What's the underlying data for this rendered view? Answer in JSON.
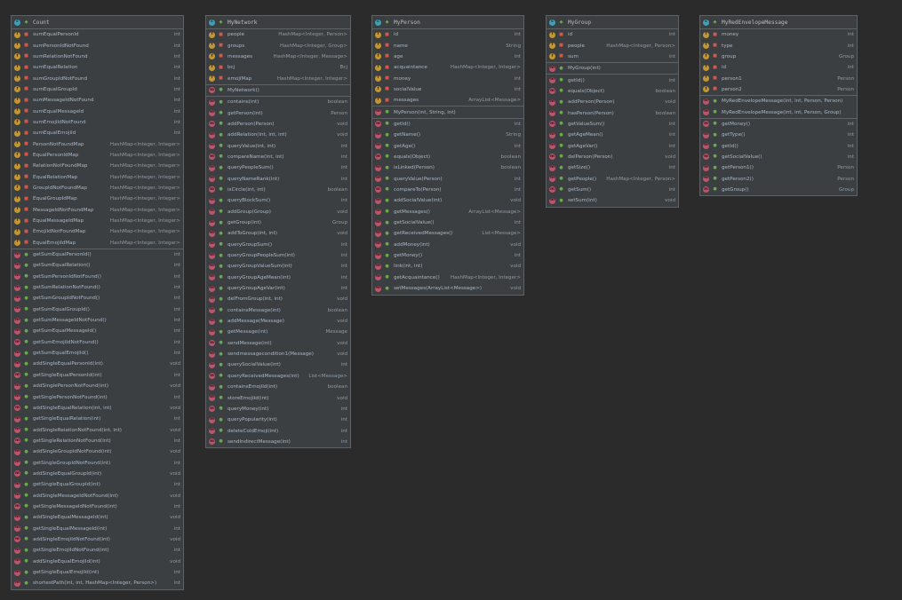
{
  "diagram": {
    "classes": [
      {
        "id": "count",
        "name": "Count",
        "fields": [
          {
            "name": "sumEqualPersonId",
            "type": "int"
          },
          {
            "name": "sumPersonIdNotFound",
            "type": "int"
          },
          {
            "name": "sumRelationNotFound",
            "type": "int"
          },
          {
            "name": "sumEqualRelation",
            "type": "int"
          },
          {
            "name": "sumGroupIdNotFound",
            "type": "int"
          },
          {
            "name": "sumEqualGroupId",
            "type": "int"
          },
          {
            "name": "sumMessageIdNotFound",
            "type": "int"
          },
          {
            "name": "sumEqualMessageId",
            "type": "int"
          },
          {
            "name": "sumEmojiIdNotFound",
            "type": "int"
          },
          {
            "name": "sumEqualEmojiId",
            "type": "int"
          },
          {
            "name": "PersonNotFoundMap",
            "type": "HashMap<Integer, Integer>"
          },
          {
            "name": "EqualPersonIdMap",
            "type": "HashMap<Integer, Integer>"
          },
          {
            "name": "RelationNotFoundMap",
            "type": "HashMap<Integer, Integer>"
          },
          {
            "name": "EqualRelationMap",
            "type": "HashMap<Integer, Integer>"
          },
          {
            "name": "GroupIdNotFoundMap",
            "type": "HashMap<Integer, Integer>"
          },
          {
            "name": "EqualGroupIdMap",
            "type": "HashMap<Integer, Integer>"
          },
          {
            "name": "MessageIdNotFoundMap",
            "type": "HashMap<Integer, Integer>"
          },
          {
            "name": "EqualMessageIdMap",
            "type": "HashMap<Integer, Integer>"
          },
          {
            "name": "EmojiIdNotFoundMap",
            "type": "HashMap<Integer, Integer>"
          },
          {
            "name": "EqualEmojiIdMap",
            "type": "HashMap<Integer, Integer>"
          }
        ],
        "constructors": [],
        "methods": [
          {
            "name": "getSumEqualPersonId()",
            "type": "int"
          },
          {
            "name": "getSumEqualRelation()",
            "type": "int"
          },
          {
            "name": "getSumPersonIdNotFound()",
            "type": "int"
          },
          {
            "name": "getSumRelationNotFound()",
            "type": "int"
          },
          {
            "name": "getSumGroupIdNotFound()",
            "type": "int"
          },
          {
            "name": "getSumEqualGroupId()",
            "type": "int"
          },
          {
            "name": "getSumMessageIdNotFound()",
            "type": "int"
          },
          {
            "name": "getSumEqualMessageId()",
            "type": "int"
          },
          {
            "name": "getSumEmojiIdNotFound()",
            "type": "int"
          },
          {
            "name": "getSumEqualEmojiId()",
            "type": "int"
          },
          {
            "name": "addSingleEqualPersonId(int)",
            "type": "void"
          },
          {
            "name": "getSingleEqualPersonId(int)",
            "type": "int"
          },
          {
            "name": "addSinglePersonNotFound(int)",
            "type": "void"
          },
          {
            "name": "getSinglePersonNotFound(int)",
            "type": "int"
          },
          {
            "name": "addSingleEqualRelation(int, int)",
            "type": "void"
          },
          {
            "name": "getSingleEqualRelation(int)",
            "type": "int"
          },
          {
            "name": "addSingleRelationNotFound(int, int)",
            "type": "void"
          },
          {
            "name": "getSingleRelationNotFound(int)",
            "type": "int"
          },
          {
            "name": "addSingleGroupIdNotFound(int)",
            "type": "void"
          },
          {
            "name": "getSingleGroupIdNotFound(int)",
            "type": "int"
          },
          {
            "name": "addSingleEqualGroupId(int)",
            "type": "void"
          },
          {
            "name": "getSingleEqualGroupId(int)",
            "type": "int"
          },
          {
            "name": "addSingleMessageIdNotFound(int)",
            "type": "void"
          },
          {
            "name": "getSingleMessageIdNotFound(int)",
            "type": "int"
          },
          {
            "name": "addSingleEqualMessageId(int)",
            "type": "void"
          },
          {
            "name": "getSingleEqualMessageId(int)",
            "type": "int"
          },
          {
            "name": "addSingleEmojiIdNotFound(int)",
            "type": "void"
          },
          {
            "name": "getSingleEmojiIdNotFound(int)",
            "type": "int"
          },
          {
            "name": "addSingleEqualEmojiId(int)",
            "type": "void"
          },
          {
            "name": "getSingleEqualEmojiId(int)",
            "type": "int"
          },
          {
            "name": "shortestPath(int, int, HashMap<Integer, Person>)",
            "type": "int"
          }
        ]
      },
      {
        "id": "mynetwork",
        "name": "MyNetwork",
        "fields": [
          {
            "name": "people",
            "type": "HashMap<Integer, Person>"
          },
          {
            "name": "groups",
            "type": "HashMap<Integer, Group>"
          },
          {
            "name": "messages",
            "type": "HashMap<Integer, Message>"
          },
          {
            "name": "bcj",
            "type": "Bcj"
          },
          {
            "name": "emojiMap",
            "type": "HashMap<Integer, Integer>"
          }
        ],
        "constructors": [
          {
            "name": "MyNetwork()",
            "type": ""
          }
        ],
        "methods": [
          {
            "name": "contains(int)",
            "type": "boolean"
          },
          {
            "name": "getPerson(int)",
            "type": "Person"
          },
          {
            "name": "addPerson(Person)",
            "type": "void"
          },
          {
            "name": "addRelation(int, int, int)",
            "type": "void"
          },
          {
            "name": "queryValue(int, int)",
            "type": "int"
          },
          {
            "name": "compareName(int, int)",
            "type": "int"
          },
          {
            "name": "queryPeopleSum()",
            "type": "int"
          },
          {
            "name": "queryNameRank(int)",
            "type": "int"
          },
          {
            "name": "isCircle(int, int)",
            "type": "boolean"
          },
          {
            "name": "queryBlockSum()",
            "type": "int"
          },
          {
            "name": "addGroup(Group)",
            "type": "void"
          },
          {
            "name": "getGroup(int)",
            "type": "Group"
          },
          {
            "name": "addToGroup(int, int)",
            "type": "void"
          },
          {
            "name": "queryGroupSum()",
            "type": "int"
          },
          {
            "name": "queryGroupPeopleSum(int)",
            "type": "int"
          },
          {
            "name": "queryGroupValueSum(int)",
            "type": "int"
          },
          {
            "name": "queryGroupAgeMean(int)",
            "type": "int"
          },
          {
            "name": "queryGroupAgeVar(int)",
            "type": "int"
          },
          {
            "name": "delFromGroup(int, int)",
            "type": "void"
          },
          {
            "name": "containsMessage(int)",
            "type": "boolean"
          },
          {
            "name": "addMessage(Message)",
            "type": "void"
          },
          {
            "name": "getMessage(int)",
            "type": "Message"
          },
          {
            "name": "sendMessage(int)",
            "type": "void"
          },
          {
            "name": "sendmessagecondition1(Message)",
            "type": "void"
          },
          {
            "name": "querySocialValue(int)",
            "type": "int"
          },
          {
            "name": "queryReceivedMessages(int)",
            "type": "List<Message>"
          },
          {
            "name": "containsEmojiId(int)",
            "type": "boolean"
          },
          {
            "name": "storeEmojiId(int)",
            "type": "void"
          },
          {
            "name": "queryMoney(int)",
            "type": "int"
          },
          {
            "name": "queryPopularity(int)",
            "type": "int"
          },
          {
            "name": "deleteColdEmoji(int)",
            "type": "int"
          },
          {
            "name": "sendIndirectMessage(int)",
            "type": "int"
          }
        ]
      },
      {
        "id": "myperson",
        "name": "MyPerson",
        "fields": [
          {
            "name": "id",
            "type": "int"
          },
          {
            "name": "name",
            "type": "String"
          },
          {
            "name": "age",
            "type": "int"
          },
          {
            "name": "acquaintance",
            "type": "HashMap<Integer, Integer>"
          },
          {
            "name": "money",
            "type": "int"
          },
          {
            "name": "socialValue",
            "type": "int"
          },
          {
            "name": "messages",
            "type": "ArrayList<Message>"
          }
        ],
        "constructors": [
          {
            "name": "MyPerson(int, String, int)",
            "type": ""
          }
        ],
        "methods": [
          {
            "name": "getId()",
            "type": "int"
          },
          {
            "name": "getName()",
            "type": "String"
          },
          {
            "name": "getAge()",
            "type": "int"
          },
          {
            "name": "equals(Object)",
            "type": "boolean"
          },
          {
            "name": "isLinked(Person)",
            "type": "boolean"
          },
          {
            "name": "queryValue(Person)",
            "type": "int"
          },
          {
            "name": "compareTo(Person)",
            "type": "int"
          },
          {
            "name": "addSocialValue(int)",
            "type": "void"
          },
          {
            "name": "getMessages()",
            "type": "ArrayList<Message>"
          },
          {
            "name": "getSocialValue()",
            "type": "int"
          },
          {
            "name": "getReceivedMessages()",
            "type": "List<Message>"
          },
          {
            "name": "addMoney(int)",
            "type": "void"
          },
          {
            "name": "getMoney()",
            "type": "int"
          },
          {
            "name": "link(int, int)",
            "type": "void"
          },
          {
            "name": "getAcquaintance()",
            "type": "HashMap<Integer, Integer>"
          },
          {
            "name": "setMessages(ArrayList<Message>)",
            "type": "void"
          }
        ]
      },
      {
        "id": "mygroup",
        "name": "MyGroup",
        "fields": [
          {
            "name": "id",
            "type": "int"
          },
          {
            "name": "people",
            "type": "HashMap<Integer, Person>"
          },
          {
            "name": "sum",
            "type": "int"
          }
        ],
        "constructors": [
          {
            "name": "MyGroup(int)",
            "type": ""
          }
        ],
        "methods": [
          {
            "name": "getId()",
            "type": "int"
          },
          {
            "name": "equals(Object)",
            "type": "boolean"
          },
          {
            "name": "addPerson(Person)",
            "type": "void"
          },
          {
            "name": "hasPerson(Person)",
            "type": "boolean"
          },
          {
            "name": "getValueSum()",
            "type": "int"
          },
          {
            "name": "getAgeMean()",
            "type": "int"
          },
          {
            "name": "getAgeVar()",
            "type": "int"
          },
          {
            "name": "delPerson(Person)",
            "type": "void"
          },
          {
            "name": "getSize()",
            "type": "int"
          },
          {
            "name": "getPeople()",
            "type": "HashMap<Integer, Person>"
          },
          {
            "name": "getSum()",
            "type": "int"
          },
          {
            "name": "setSum(int)",
            "type": "void"
          }
        ]
      },
      {
        "id": "myredenvelopemessage",
        "name": "MyRedEnvelopeMessage",
        "fields": [
          {
            "name": "money",
            "type": "int"
          },
          {
            "name": "type",
            "type": "int"
          },
          {
            "name": "group",
            "type": "Group"
          },
          {
            "name": "id",
            "type": "int"
          },
          {
            "name": "person1",
            "type": "Person"
          },
          {
            "name": "person2",
            "type": "Person"
          }
        ],
        "constructors": [
          {
            "name": "MyRedEnvelopeMessage(int, int, Person, Person)",
            "type": ""
          },
          {
            "name": "MyRedEnvelopeMessage(int, int, Person, Group)",
            "type": ""
          }
        ],
        "methods": [
          {
            "name": "getMoney()",
            "type": "int"
          },
          {
            "name": "getType()",
            "type": "int"
          },
          {
            "name": "getId()",
            "type": "int"
          },
          {
            "name": "getSocialValue()",
            "type": "int"
          },
          {
            "name": "getPerson1()",
            "type": "Person"
          },
          {
            "name": "getPerson2()",
            "type": "Person"
          },
          {
            "name": "getGroup()",
            "type": "Group"
          }
        ]
      }
    ]
  }
}
